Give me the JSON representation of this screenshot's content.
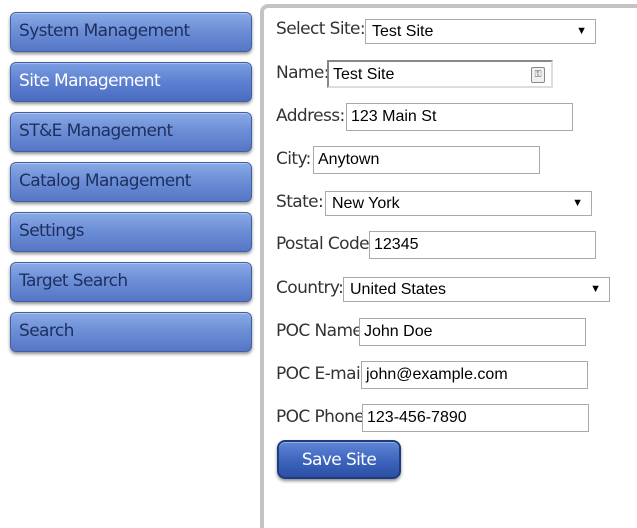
{
  "sidebar": {
    "items": [
      {
        "label": "System Management",
        "active": false
      },
      {
        "label": "Site Management",
        "active": true
      },
      {
        "label": "ST&E Management",
        "active": false
      },
      {
        "label": "Catalog Management",
        "active": false
      },
      {
        "label": "Settings",
        "active": false
      },
      {
        "label": "Target Search",
        "active": false
      },
      {
        "label": "Search",
        "active": false
      }
    ]
  },
  "form": {
    "select_site": {
      "label": "Select Site:",
      "value": "Test Site"
    },
    "name": {
      "label": "Name:",
      "value": "Test Site"
    },
    "address": {
      "label": "Address:",
      "value": "123 Main St"
    },
    "city": {
      "label": "City:",
      "value": "Anytown"
    },
    "state": {
      "label": "State:",
      "value": "New York"
    },
    "postal_code": {
      "label": "Postal Code:",
      "value": "12345"
    },
    "country": {
      "label": "Country:",
      "value": "United States"
    },
    "poc_name": {
      "label": "POC Name:",
      "value": "John Doe"
    },
    "poc_email": {
      "label": "POC E-mail:",
      "value": "john@example.com"
    },
    "poc_phone": {
      "label": "POC Phone:",
      "value": "123-456-7890"
    },
    "save_label": "Save Site"
  },
  "colors": {
    "nav_top": "#89a9e5",
    "nav_bottom": "#5676c6",
    "button": "#3d64bd",
    "panel_border": "#c4c4c4"
  }
}
